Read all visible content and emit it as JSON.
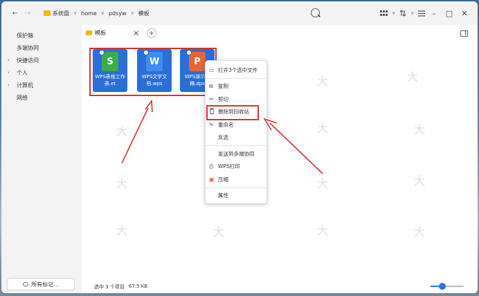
{
  "nav": {
    "back": "←",
    "forward": "→"
  },
  "breadcrumb": [
    {
      "label": "系统盘",
      "caret": "∨"
    },
    {
      "label": "home",
      "caret": "∨"
    },
    {
      "label": "pdsyw",
      "caret": "∨"
    },
    {
      "label": "模板",
      "caret": ""
    }
  ],
  "toolbar": {
    "view_icon": "grid-view-icon",
    "sort_icon": "sort-icon",
    "menu_icon": "menu-icon",
    "minimize": "–",
    "maximize": "□",
    "close": "✕"
  },
  "sidebar": {
    "items": [
      {
        "label": "保护箱",
        "arrow": ""
      },
      {
        "label": "多端协同",
        "arrow": ""
      },
      {
        "label": "快捷访问",
        "arrow": "›"
      },
      {
        "label": "个人",
        "arrow": "›"
      },
      {
        "label": "计算机",
        "arrow": "›"
      },
      {
        "label": "网络",
        "arrow": ""
      }
    ],
    "bottom_button": "所有标记..."
  },
  "tab": {
    "label": "模板",
    "close": "✕",
    "add": "+"
  },
  "files": [
    {
      "name": "WPS表格工作表.et",
      "icon": "wps-spreadsheet-icon",
      "glyph": "S",
      "color": "#3cab4a"
    },
    {
      "name": "WPS文字文档.wps",
      "icon": "wps-writer-icon",
      "glyph": "W",
      "color": "#3f8cf3"
    },
    {
      "name": "WPS演示文稿.dps",
      "icon": "wps-presentation-icon",
      "glyph": "P",
      "color": "#e8643a"
    }
  ],
  "context_menu": {
    "items": [
      {
        "label": "打开3个选中文件",
        "icon": "folder-open-icon",
        "glyph": "▭"
      },
      {
        "sep": true
      },
      {
        "label": "复制",
        "icon": "copy-icon",
        "glyph": "⧉"
      },
      {
        "label": "剪切",
        "icon": "cut-icon",
        "glyph": "✂"
      },
      {
        "label": "删除到回收站",
        "icon": "trash-icon",
        "glyph": "🗑"
      },
      {
        "label": "重命名",
        "icon": "rename-icon",
        "glyph": "✎"
      },
      {
        "label": "反选",
        "icon": "",
        "glyph": ""
      },
      {
        "sep": true
      },
      {
        "label": "发送到多端协同",
        "icon": "",
        "glyph": ""
      },
      {
        "label": "WPS打印",
        "icon": "print-icon",
        "glyph": "⎙"
      },
      {
        "label": "压缩",
        "icon": "compress-icon",
        "glyph": "▣"
      },
      {
        "sep": true
      },
      {
        "label": "属性",
        "icon": "",
        "glyph": ""
      }
    ]
  },
  "status": {
    "selected": "选中 3 个项目",
    "size": "67.5 KB"
  },
  "colors": {
    "selection_blue": "#2a6fd7",
    "annotation_red": "#d23333",
    "accent": "#2a72e5"
  },
  "zoom": {
    "level_fraction": 0.42
  }
}
